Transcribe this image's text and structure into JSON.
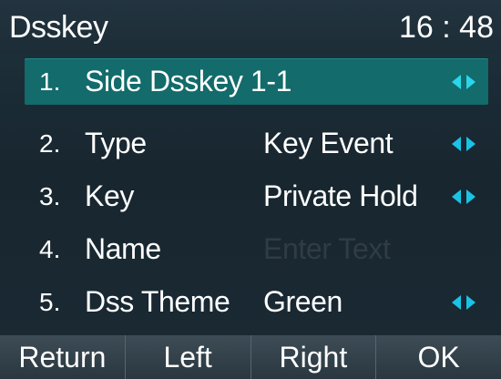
{
  "header": {
    "title": "Dsskey",
    "time": "16 : 48"
  },
  "rows": [
    {
      "num": "1.",
      "label": "Side Dsskey 1-1",
      "value": "",
      "arrows": true,
      "selected": true
    },
    {
      "num": "2.",
      "label": "Type",
      "value": "Key Event",
      "arrows": true
    },
    {
      "num": "3.",
      "label": "Key",
      "value": "Private Hold",
      "arrows": true
    },
    {
      "num": "4.",
      "label": "Name",
      "placeholder": "Enter Text",
      "arrows": false
    },
    {
      "num": "5.",
      "label": "Dss Theme",
      "value": "Green",
      "arrows": true
    }
  ],
  "softkeys": {
    "return": "Return",
    "left": "Left",
    "right": "Right",
    "ok": "OK"
  },
  "colors": {
    "selection": "#136b6b",
    "arrow": "#19c3e6",
    "placeholder": "#2f3c44"
  },
  "icons": {
    "arrows": "left-right-arrows-icon"
  }
}
